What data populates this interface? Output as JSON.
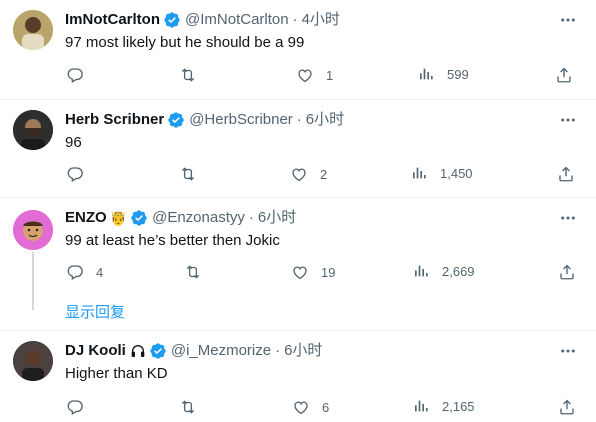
{
  "tweets": [
    {
      "name": "ImNotCarlton",
      "handle": "@ImNotCarlton",
      "time": "4小时",
      "text": "97 most likely but he should be a 99",
      "replies": "",
      "retweets": "",
      "likes": "1",
      "views": "599",
      "verified": true,
      "avatar": "person-photo"
    },
    {
      "name": "Herb Scribner",
      "handle": "@HerbScribner",
      "time": "6小时",
      "text": "96",
      "replies": "",
      "retweets": "",
      "likes": "2",
      "views": "1,450",
      "verified": true,
      "avatar": "person-photo"
    },
    {
      "name": "ENZO",
      "emoji": "🤴",
      "handle": "@Enzonastyy",
      "time": "6小时",
      "text": "99 at least he’s better then Jokic",
      "replies": "4",
      "retweets": "",
      "likes": "19",
      "views": "2,669",
      "verified": true,
      "avatar": "cartoon-avatar"
    },
    {
      "name": "DJ Kooli",
      "handle": "@i_Mezmorize",
      "time": "6小时",
      "text": "Higher than KD",
      "replies": "",
      "retweets": "",
      "likes": "6",
      "views": "2,165",
      "verified": true,
      "avatar": "person-photo"
    }
  ],
  "show_replies_label": "显示回复",
  "colors": {
    "verified_blue": "#1d9bf0",
    "text": "#0f1419",
    "secondary": "#536471",
    "divider": "#eff3f4"
  }
}
